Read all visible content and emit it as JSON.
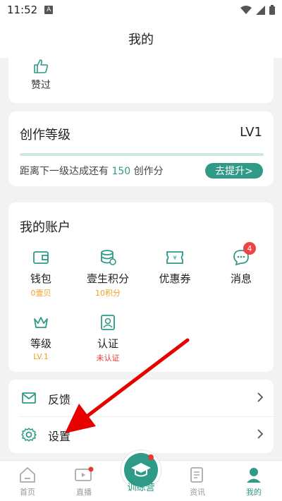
{
  "status": {
    "time": "11:52",
    "notification_icon": "A"
  },
  "header": {
    "title": "我的"
  },
  "likes": {
    "label": "赞过"
  },
  "level": {
    "title": "创作等级",
    "value": "LV1",
    "progress": 0.0,
    "desc_prefix": "距离下一级达成还有",
    "desc_num": "150",
    "desc_suffix": "创作分",
    "upgrade_label": "去提升>"
  },
  "account": {
    "title": "我的账户",
    "items": [
      {
        "label": "钱包",
        "sub": "0壹贝",
        "icon": "wallet-icon"
      },
      {
        "label": "壹生积分",
        "sub": "10积分",
        "icon": "points-icon"
      },
      {
        "label": "优惠券",
        "sub": "",
        "icon": "coupon-icon"
      },
      {
        "label": "消息",
        "sub": "",
        "icon": "message-icon",
        "badge": "4"
      },
      {
        "label": "等级",
        "sub": "LV.1",
        "icon": "crown-icon"
      },
      {
        "label": "认证",
        "sub": "未认证",
        "icon": "certification-icon"
      }
    ]
  },
  "menu": [
    {
      "label": "反馈",
      "icon": "mail-icon"
    },
    {
      "label": "设置",
      "icon": "gear-icon"
    }
  ],
  "tabbar": {
    "tabs": [
      {
        "label": "首页",
        "icon": "home-icon"
      },
      {
        "label": "直播",
        "icon": "live-icon"
      },
      {
        "label": "训练营",
        "icon": "graduation-cap-icon"
      },
      {
        "label": "资讯",
        "icon": "news-icon"
      },
      {
        "label": "我的",
        "icon": "profile-icon"
      }
    ]
  },
  "colors": {
    "accent": "#2f9a87",
    "badge": "#ef4444",
    "orange": "#f0a020",
    "annotation": "#e60000"
  }
}
